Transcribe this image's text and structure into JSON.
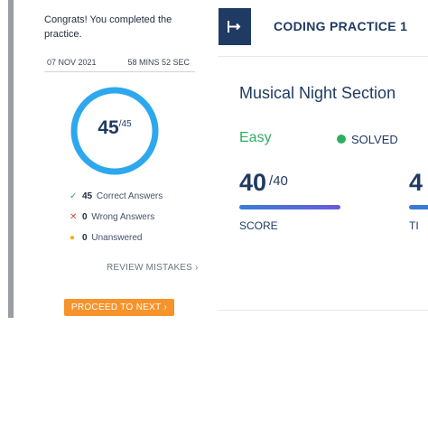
{
  "colors": {
    "navy": "#1f3b63",
    "ring": "#2da8ee",
    "success": "#2fae62",
    "error": "#d94a3d",
    "warning": "#f0b400",
    "button": "#f7932b"
  },
  "result_card": {
    "message": "Congrats! You completed the practice.",
    "date": "07 NOV 2021",
    "duration": "58 MINS 52 SEC",
    "score": "45",
    "score_total": "/45",
    "stats": [
      {
        "icon": "check-icon",
        "count": "45",
        "label": "Correct Answers"
      },
      {
        "icon": "cross-icon",
        "count": "0",
        "label": "Wrong Answers"
      },
      {
        "icon": "dot-icon",
        "count": "0",
        "label": "Unanswered"
      }
    ],
    "review_label": "REVIEW MISTAKES",
    "proceed_label": "PROCEED TO NEXT"
  },
  "header": {
    "icon": "exit-arrow-icon",
    "title": "CODING PRACTICE 1"
  },
  "problem": {
    "title": "Musical Night Section",
    "difficulty": "Easy",
    "status": "SOLVED",
    "score_value": "40",
    "score_total": "/40",
    "score_fraction": 1.0,
    "score_label": "SCORE",
    "cut_value": "4",
    "cut_label": "TI"
  }
}
